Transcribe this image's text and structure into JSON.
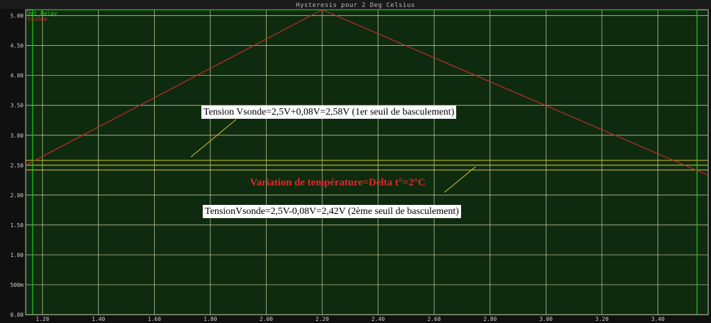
{
  "window": {
    "title": "Hysteresis pour 2 Deg Celsius"
  },
  "colors": {
    "background": "#0f2b0f",
    "grid": "#d8d8a8",
    "vsonde": "#c42a2a",
    "out_relay": "#22cc22",
    "threshold": "#d8c830"
  },
  "chart_data": {
    "type": "line",
    "title": "Hysteresis pour 2 Deg Celsius",
    "xlim": [
      1.14,
      3.58
    ],
    "ylim": [
      0,
      5.1
    ],
    "x_ticks": [
      "1.20",
      "1.40",
      "1.60",
      "1.80",
      "2.00",
      "2.20",
      "2.40",
      "2.60",
      "2.80",
      "3.00",
      "3.20",
      "3.40"
    ],
    "y_ticks": [
      "0.00",
      "500m",
      "1.00",
      "1.50",
      "2.00",
      "2.50",
      "3.00",
      "3.50",
      "4.00",
      "4.50",
      "5.00"
    ],
    "grid": true,
    "legend_position": "top-left",
    "series": [
      {
        "name": "Out_Relay",
        "color": "#22cc22",
        "x": [
          1.165,
          1.165,
          3.54,
          3.54
        ],
        "y": [
          0,
          5.1,
          5.1,
          0
        ]
      },
      {
        "name": "Vsonde",
        "color": "#c42a2a",
        "x": [
          1.14,
          2.2,
          3.58
        ],
        "y": [
          2.5,
          5.1,
          2.33
        ]
      }
    ],
    "thresholds": [
      2.58,
      2.5,
      2.42
    ],
    "annotations": {
      "upper": "Tension Vsonde=2,5V+0,08V=2,58V (1er seuil de basculement)",
      "middle": "Variation de température=Delta t°=2°C",
      "lower": "TensionVsonde=2,5V-0,08V=2,42V (2ème seuil de basculement)"
    }
  }
}
